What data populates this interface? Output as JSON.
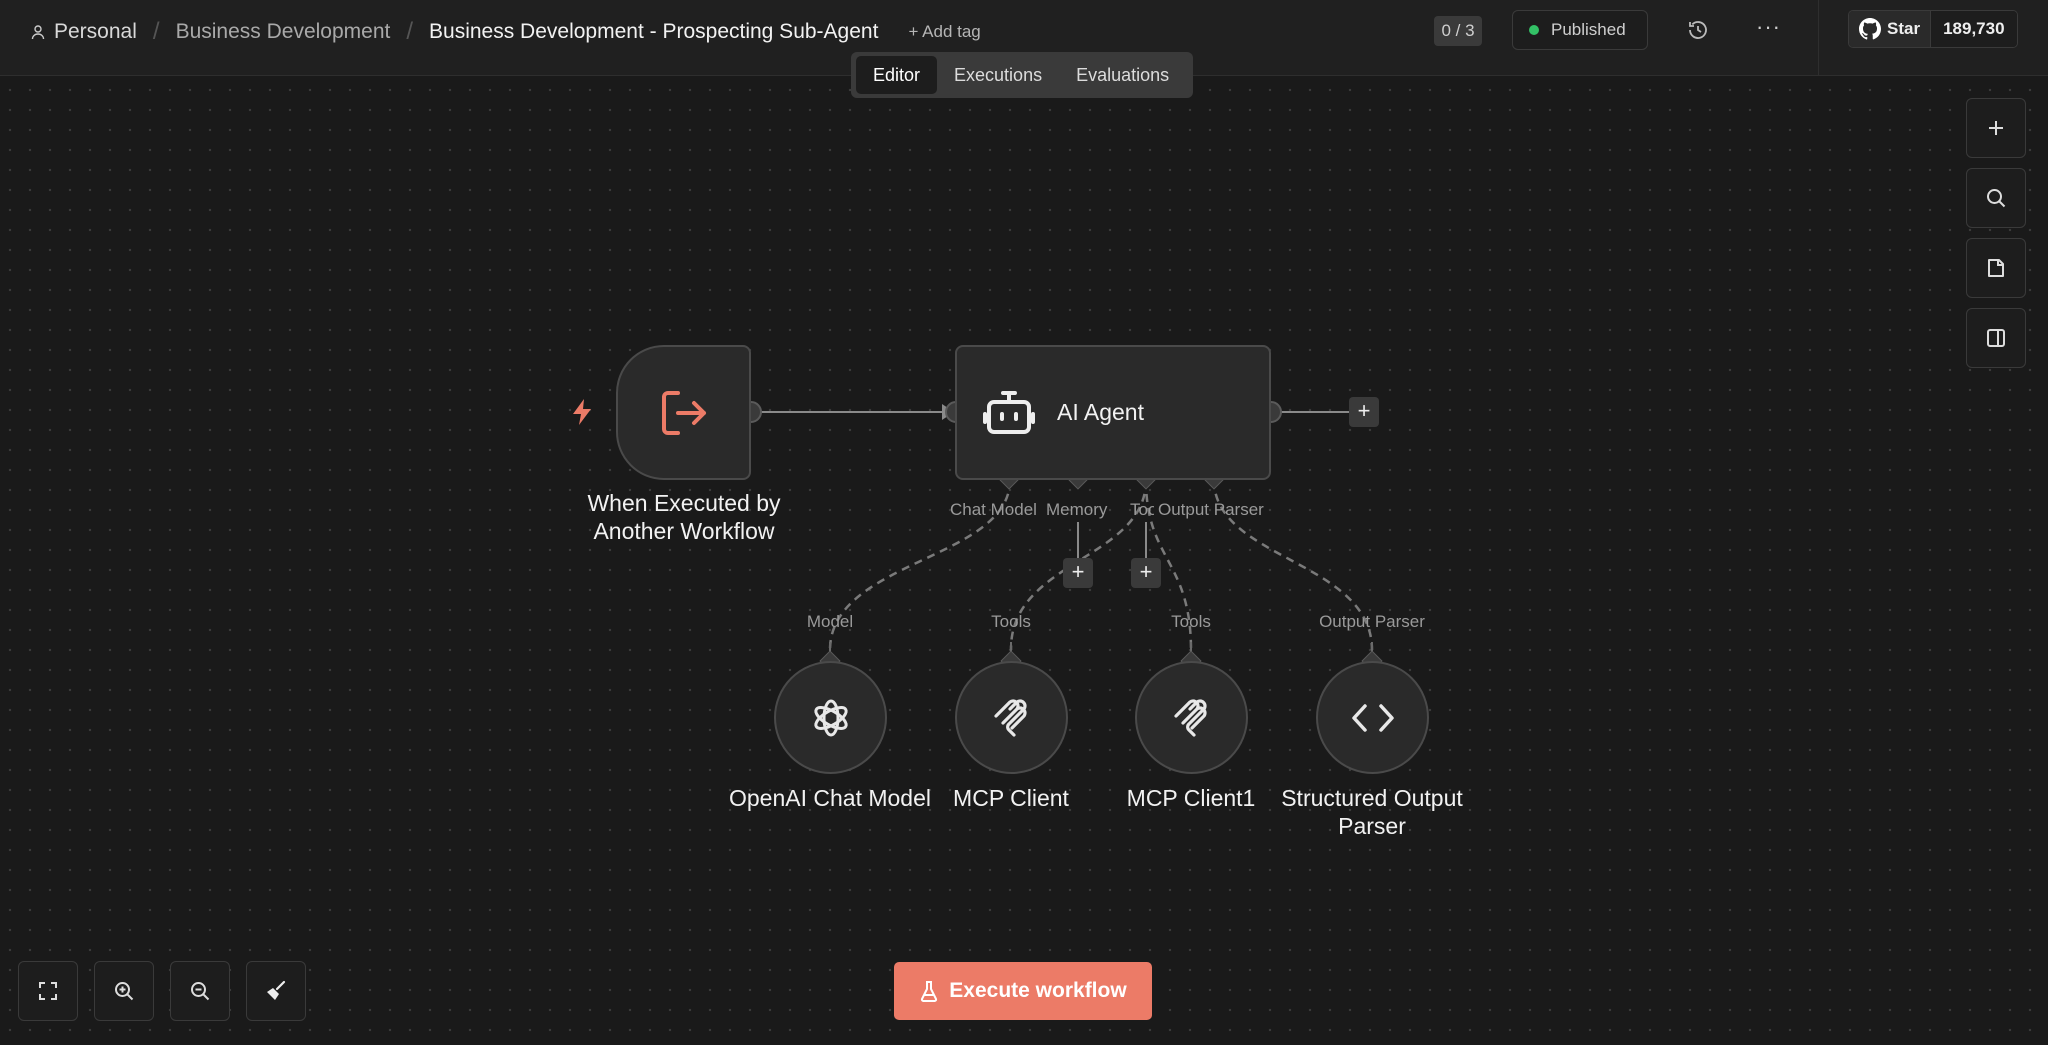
{
  "breadcrumb": {
    "personal": "Personal",
    "folder": "Business Development",
    "workflow": "Business Development - Prospecting Sub-Agent",
    "add_tag": "+ Add tag"
  },
  "tabs": [
    "Editor",
    "Executions",
    "Evaluations"
  ],
  "active_tab": "Editor",
  "header": {
    "counter": "0 / 3",
    "status": "Published",
    "more": "···",
    "github_star": "Star",
    "github_count": "189,730"
  },
  "nodes": {
    "trigger": {
      "title": "When Executed by Another Workflow",
      "line1": "When Executed by",
      "line2": "Another Workflow"
    },
    "agent": {
      "title": "AI Agent"
    },
    "openai": {
      "title": "OpenAI Chat Model"
    },
    "mcp1": {
      "title": "MCP Client"
    },
    "mcp2": {
      "title": "MCP Client1"
    },
    "parser": {
      "title": "Structured Output Parser",
      "line1": "Structured Output",
      "line2": "Parser"
    }
  },
  "agent_ports": {
    "chat_model": "Chat Model",
    "memory": "Memory",
    "tool": "Tool",
    "output_parser": "Output Parser"
  },
  "sub_ports": {
    "model": "Model",
    "tools1": "Tools",
    "tools2": "Tools",
    "output_parser": "Output Parser"
  },
  "execute_button": "Execute workflow",
  "colors": {
    "accent": "#ec7b67",
    "published": "#33c166",
    "canvas": "#1a1a1a"
  },
  "icons": {
    "trigger": "sign-out-icon",
    "agent": "robot-icon",
    "openai": "openai-icon",
    "mcp": "mcp-icon",
    "parser": "code-brackets-icon"
  }
}
